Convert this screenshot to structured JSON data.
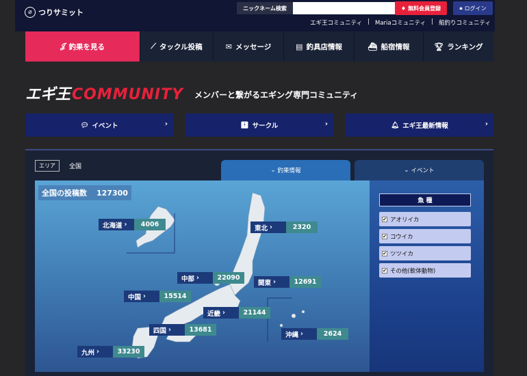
{
  "header": {
    "logo_text": "つりサミット",
    "nickname_search_label": "ニックネーム検索",
    "nickname_search_value": "",
    "signup_label": "無料会員登録",
    "login_label": "ログイン",
    "community_links": [
      "エギ王コミュニティ",
      "Mariaコミュニティ",
      "船釣りコミュニティ"
    ]
  },
  "nav": {
    "items": [
      {
        "label": "釣果を見る",
        "icon": "hook-icon",
        "active": true
      },
      {
        "label": "タックル投稿",
        "icon": "rod-icon"
      },
      {
        "label": "メッセージ",
        "icon": "envelope-icon"
      },
      {
        "label": "釣具店情報",
        "icon": "shop-icon"
      },
      {
        "label": "船宿情報",
        "icon": "boat-icon"
      },
      {
        "label": "ランキング",
        "icon": "trophy-icon"
      }
    ]
  },
  "brand": {
    "egi": "エギ王",
    "community": "COMMUNITY",
    "subtitle": "メンバーと繋がるエギング専門コミュニティ"
  },
  "subbuttons": [
    {
      "label": "イベント",
      "icon": "chat-icon"
    },
    {
      "label": "サークル",
      "icon": "person-icon"
    },
    {
      "label": "エギ王最新情報",
      "icon": "bell-icon"
    }
  ],
  "panel": {
    "area_tag": "エリア",
    "area_value": "全国",
    "tabs": [
      {
        "label": "釣果情報",
        "active": true
      },
      {
        "label": "イベント",
        "active": false
      }
    ],
    "total_label": "全国の投稿数",
    "total_value": "127300",
    "regions": {
      "hokkaido": {
        "name": "北海道",
        "count": "4006"
      },
      "tohoku": {
        "name": "東北",
        "count": "2320"
      },
      "chubu": {
        "name": "中部",
        "count": "22090"
      },
      "kanto": {
        "name": "関東",
        "count": "12691"
      },
      "chugoku": {
        "name": "中国",
        "count": "15514"
      },
      "kinki": {
        "name": "近畿",
        "count": "21144"
      },
      "shikoku": {
        "name": "四国",
        "count": "13681"
      },
      "okinawa": {
        "name": "沖縄",
        "count": "2624"
      },
      "kyushu": {
        "name": "九州",
        "count": "33230"
      }
    },
    "fish": {
      "heading": "魚 種",
      "items": [
        "アオリイカ",
        "コウイカ",
        "ツツイカ",
        "その他(軟体動物)"
      ]
    }
  },
  "colors": {
    "header_bg": "#101633",
    "nav_active": "#e62a5a",
    "accent_red": "#e8213b",
    "subbutton_bg": "#16226a"
  }
}
